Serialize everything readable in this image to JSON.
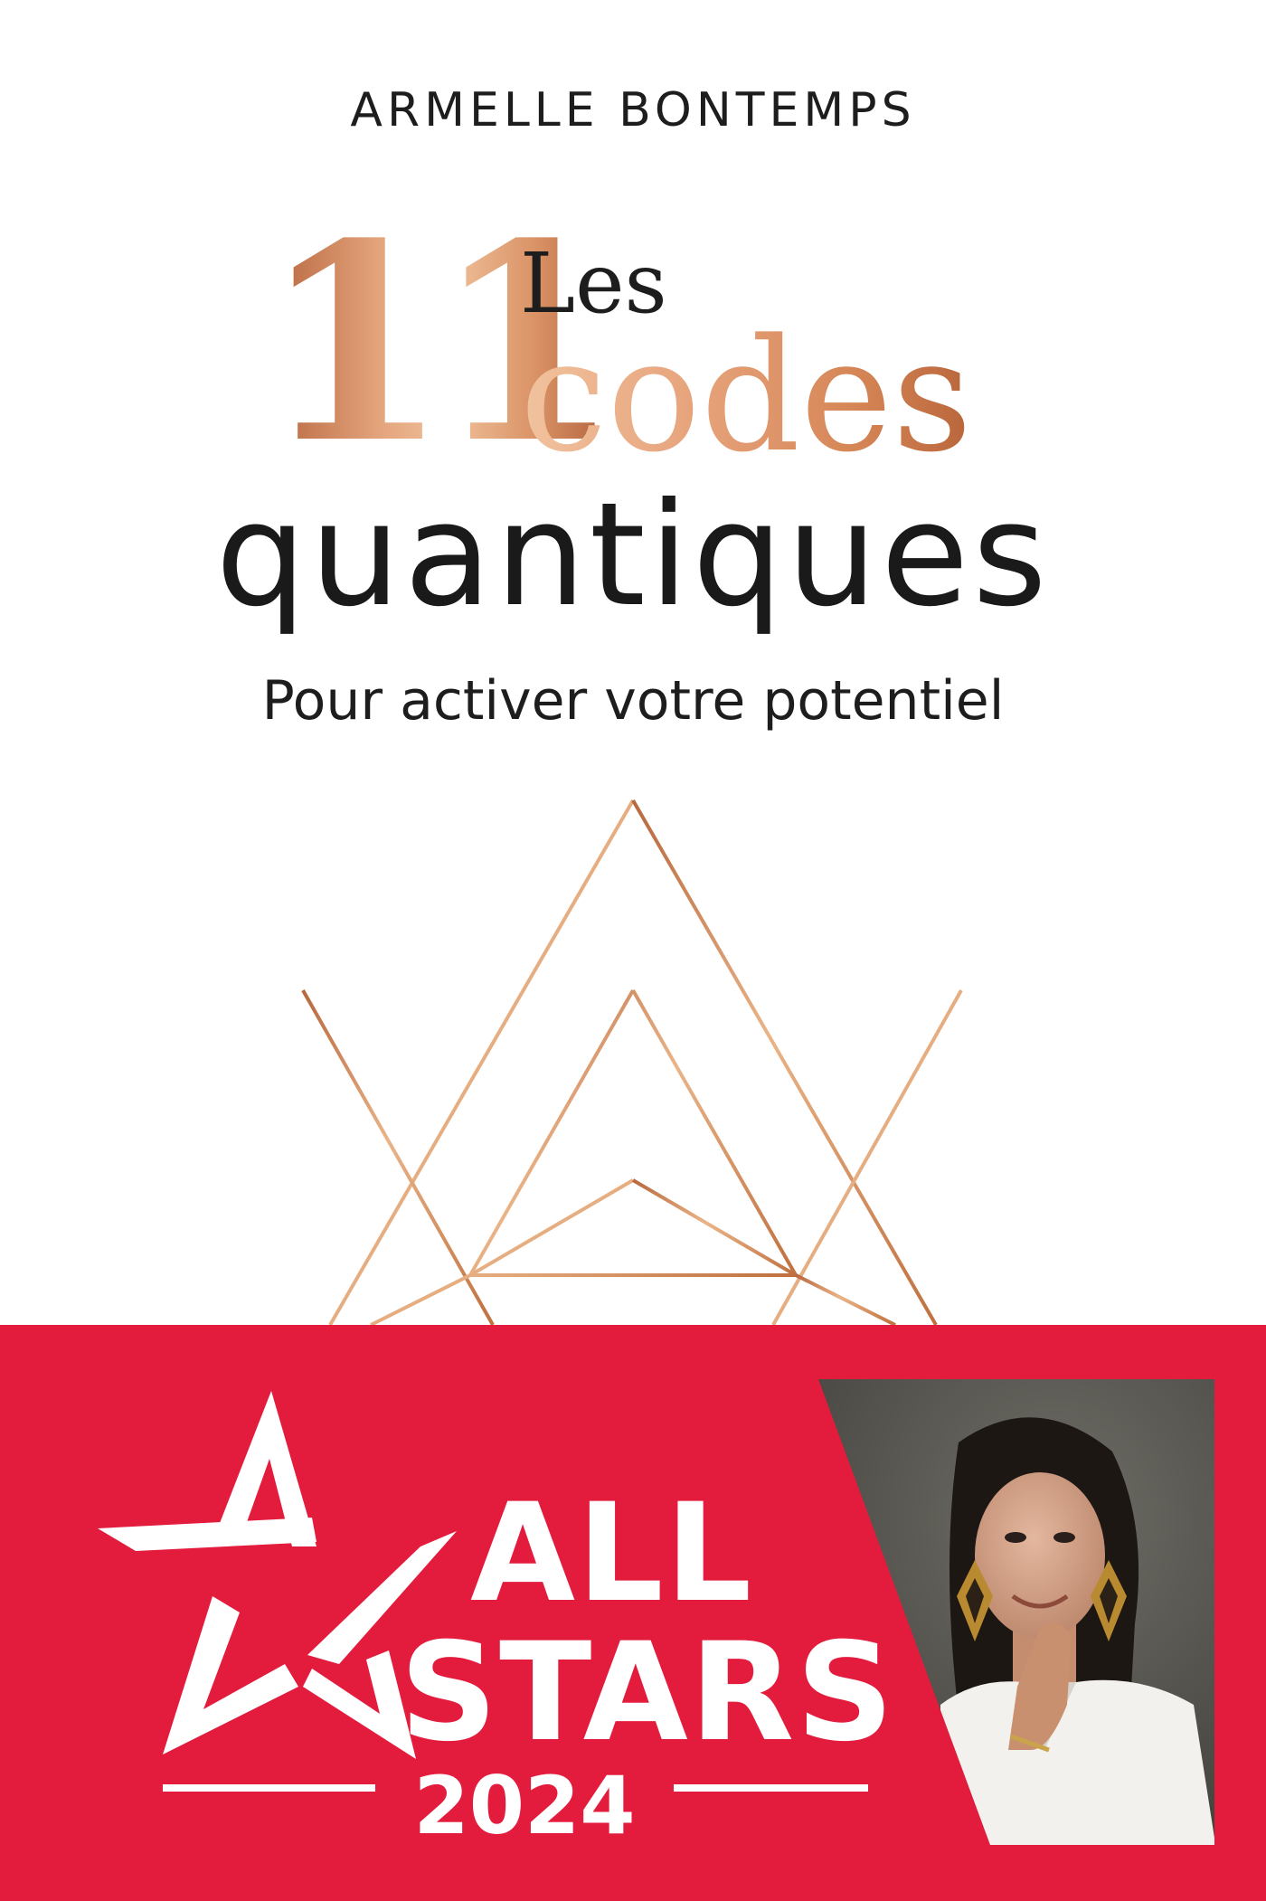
{
  "cover": {
    "author": "ARMELLE BONTEMPS",
    "title_number": "11",
    "title_les": "Les",
    "title_codes": "codes",
    "title_quantiques": "quantiques",
    "subtitle": "Pour activer votre potentiel"
  },
  "banner": {
    "line1": "ALL",
    "line2": "STARS",
    "year": "2024"
  },
  "colors": {
    "accent_red": "#e31c3d",
    "copper": "#c7794c",
    "text_dark": "#1d1d1d"
  },
  "icons": {
    "geometry": "merkaba-star-icon",
    "banner_star": "star-outline-icon",
    "portrait": "author-portrait"
  }
}
